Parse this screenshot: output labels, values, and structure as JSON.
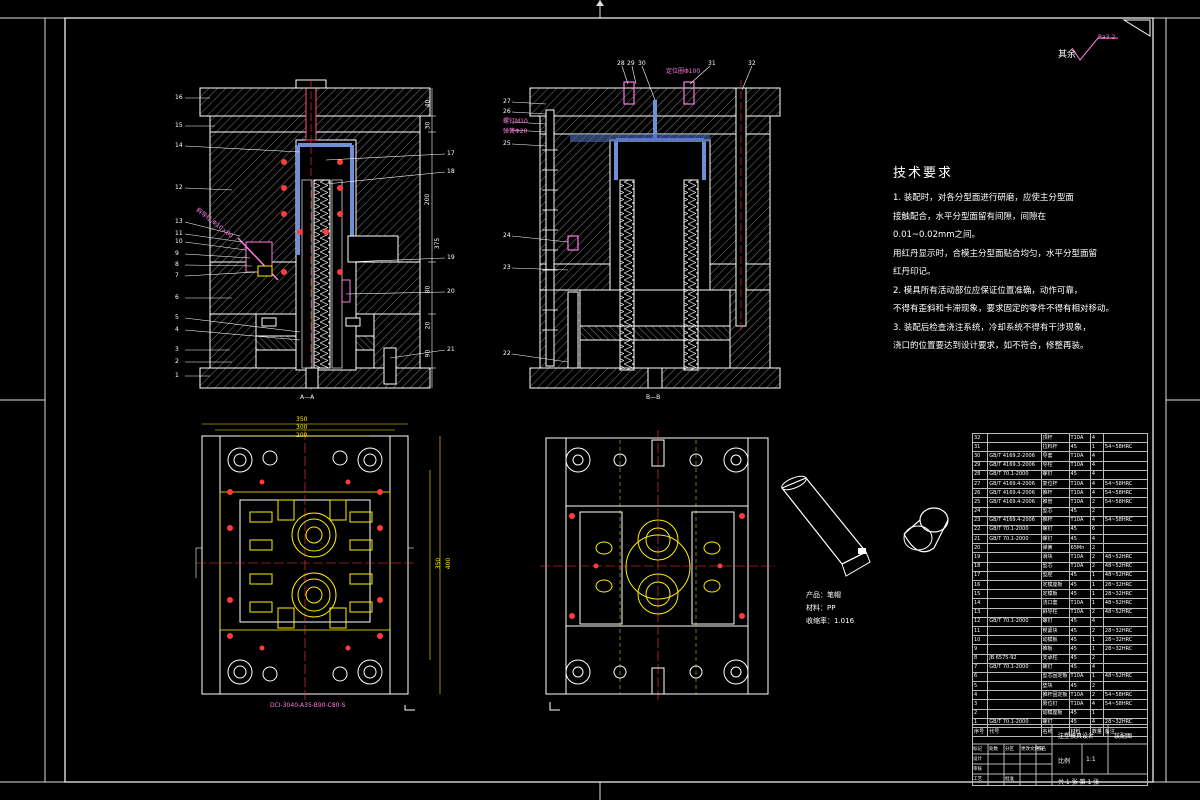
{
  "drawing": {
    "roughness_label": "其余",
    "roughness_value": "Ra3.2",
    "tech_requirements": {
      "title": "技术要求",
      "lines": [
        "1. 装配时，对各分型面进行研磨，应使主分型面",
        "接触配合，水平分型面留有间隙，间隙在",
        "0.01~0.02mm之间。",
        "用红丹显示时，合模主分型面贴合均匀，水平分型面留",
        "红丹印记。",
        "2. 模具所有活动部位应保证位置准确，动作可靠，",
        "不得有歪斜和卡滞现象，要求固定的零件不得有相对移动。",
        "3. 装配后检查浇注系统，冷却系统不得有干涉现象，",
        "浇口的位置要达到设计要求，如不符合，修整再装。"
      ]
    },
    "product": {
      "name_line": "产品：笔帽",
      "material_line": "材料：PP",
      "shrink_line": "收缩率：1.016"
    },
    "section_labels": {
      "left": "A—A",
      "right": "B—B"
    },
    "annotations": {
      "left_slider_note": "斜导柱 Φ10×80",
      "bottom_plate_note": "DCI-3040-A35-B90-C80-S",
      "top_note": "定位圈Φ100",
      "side_notes": [
        "螺钉M10",
        "弹簧Φ20"
      ]
    },
    "left_part_numbers": [
      "16",
      "15",
      "14",
      "13",
      "12",
      "11",
      "10",
      "9",
      "8",
      "7",
      "6",
      "5",
      "4",
      "3",
      "2",
      "1"
    ],
    "left_part_numbers_right": [
      "17",
      "18",
      "19",
      "20",
      "21"
    ],
    "right_part_numbers_top": [
      "28",
      "29",
      "30",
      "31",
      "32"
    ],
    "right_part_numbers_left": [
      "27",
      "26",
      "25",
      "24",
      "23",
      "22"
    ],
    "dimensions": {
      "top_width": "350",
      "inner_width": "300",
      "slot_width": "200",
      "height_left": "400",
      "height_mid": "350",
      "vert": [
        "40",
        "30",
        "200",
        "375",
        "80",
        "20",
        "90"
      ]
    },
    "bom": {
      "rows": [
        [
          "32",
          "",
          "顶杆",
          "T10A",
          "4",
          ""
        ],
        [
          "31",
          "",
          "拉料杆",
          "45",
          "1",
          "54~58HRC"
        ],
        [
          "30",
          "GB/T 4169.2-2006",
          "导套",
          "T10A",
          "4",
          ""
        ],
        [
          "29",
          "GB/T 4169.3-2006",
          "导柱",
          "T10A",
          "4",
          ""
        ],
        [
          "28",
          "GB/T 70.1-2000",
          "螺钉",
          "45",
          "4",
          ""
        ],
        [
          "27",
          "GB/T 4169.4-2006",
          "复位杆",
          "T10A",
          "4",
          "54~58HRC"
        ],
        [
          "26",
          "GB/T 4169.4-2006",
          "推杆",
          "T10A",
          "4",
          "54~58HRC"
        ],
        [
          "25",
          "GB/T 4169.4-2006",
          "推管",
          "T10A",
          "2",
          "54~58HRC"
        ],
        [
          "24",
          "",
          "型芯",
          "45",
          "2",
          ""
        ],
        [
          "23",
          "GB/T 4169.4-2006",
          "推杆",
          "T10A",
          "4",
          "54~58HRC"
        ],
        [
          "22",
          "GB/T 70.1-2000",
          "螺钉",
          "45",
          "6",
          ""
        ],
        [
          "21",
          "GB/T 70.1-2000",
          "螺钉",
          "45",
          "4",
          ""
        ],
        [
          "20",
          "",
          "弹簧",
          "65Mn",
          "2",
          ""
        ],
        [
          "19",
          "",
          "滑块",
          "T10A",
          "2",
          "48~52HRC"
        ],
        [
          "18",
          "",
          "型芯",
          "T10A",
          "2",
          "48~52HRC"
        ],
        [
          "17",
          "",
          "型腔",
          "45",
          "1",
          "48~52HRC"
        ],
        [
          "16",
          "",
          "定模座板",
          "45",
          "1",
          "28~32HRC"
        ],
        [
          "15",
          "",
          "定模板",
          "45",
          "1",
          "28~32HRC"
        ],
        [
          "14",
          "",
          "浇口套",
          "T10A",
          "1",
          "48~52HRC"
        ],
        [
          "13",
          "",
          "斜导柱",
          "T10A",
          "2",
          "48~52HRC"
        ],
        [
          "12",
          "GB/T 70.1-2000",
          "螺钉",
          "45",
          "4",
          ""
        ],
        [
          "11",
          "",
          "楔紧块",
          "45",
          "2",
          "28~32HRC"
        ],
        [
          "10",
          "",
          "动模板",
          "45",
          "1",
          "28~32HRC"
        ],
        [
          "9",
          "",
          "推板",
          "45",
          "1",
          "28~32HRC"
        ],
        [
          "8",
          "JB 6575-92",
          "支承柱",
          "45",
          "2",
          ""
        ],
        [
          "7",
          "GB/T 70.1-2000",
          "螺钉",
          "45",
          "4",
          ""
        ],
        [
          "6",
          "",
          "型芯固定板",
          "T10A",
          "1",
          "48~52HRC"
        ],
        [
          "5",
          "",
          "垫块",
          "45",
          "2",
          ""
        ],
        [
          "4",
          "",
          "推杆固定板",
          "T10A",
          "2",
          "54~58HRC"
        ],
        [
          "3",
          "",
          "限位钉",
          "T10A",
          "4",
          "54~58HRC"
        ],
        [
          "2",
          "",
          "动模座板",
          "45",
          "1",
          ""
        ],
        [
          "1",
          "GB/T 70.1-2000",
          "螺钉",
          "45",
          "4",
          "28~32HRC"
        ]
      ],
      "header": [
        "序号",
        "代号",
        "名称",
        "材料",
        "数量",
        "备注"
      ]
    },
    "title_block": {
      "design_title": "注塑模具设计",
      "drawing_name": "装配图",
      "scale_label": "比例",
      "scale_value": "1:1",
      "sheet_label": "共 1 张 第 1 张",
      "fields": [
        "标记",
        "处数",
        "分区",
        "更改文件号",
        "签名",
        "日期",
        "设计",
        "审核",
        "工艺",
        "批准"
      ]
    }
  }
}
